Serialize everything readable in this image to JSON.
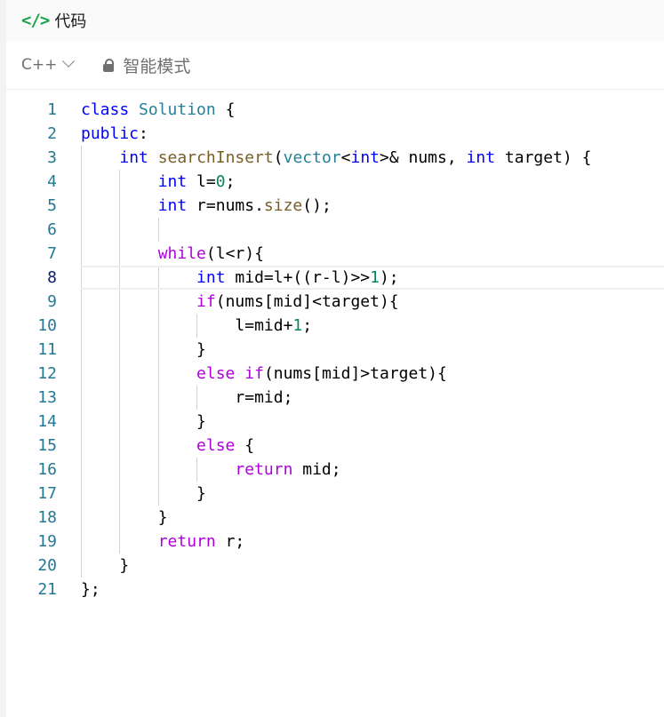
{
  "header": {
    "icon": "code-icon",
    "title": "代码",
    "icon_color": "#1aa34a"
  },
  "toolbar": {
    "language": "C++",
    "mode_icon": "lock-icon",
    "mode_label": "智能模式"
  },
  "editor": {
    "active_line": 8,
    "lines": [
      [
        [
          "class",
          "kw"
        ],
        [
          " ",
          "txt"
        ],
        [
          "Solution",
          "type"
        ],
        [
          " {",
          "txt"
        ]
      ],
      [
        [
          "public",
          "kw"
        ],
        [
          ":",
          "txt"
        ]
      ],
      [
        [
          "    ",
          "txt"
        ],
        [
          "int",
          "kw"
        ],
        [
          " ",
          "txt"
        ],
        [
          "searchInsert",
          "fn"
        ],
        [
          "(",
          "txt"
        ],
        [
          "vector",
          "type"
        ],
        [
          "<",
          "txt"
        ],
        [
          "int",
          "kw"
        ],
        [
          ">& nums, ",
          "txt"
        ],
        [
          "int",
          "kw"
        ],
        [
          " target) {",
          "txt"
        ]
      ],
      [
        [
          "        ",
          "txt"
        ],
        [
          "int",
          "kw"
        ],
        [
          " l=",
          "txt"
        ],
        [
          "0",
          "num"
        ],
        [
          ";",
          "txt"
        ]
      ],
      [
        [
          "        ",
          "txt"
        ],
        [
          "int",
          "kw"
        ],
        [
          " r=nums.",
          "txt"
        ],
        [
          "size",
          "fn"
        ],
        [
          "();",
          "txt"
        ]
      ],
      [],
      [
        [
          "        ",
          "txt"
        ],
        [
          "while",
          "ctl"
        ],
        [
          "(l<r){",
          "txt"
        ]
      ],
      [
        [
          "            ",
          "txt"
        ],
        [
          "int",
          "kw"
        ],
        [
          " mid=l+((r-l)>>",
          "txt"
        ],
        [
          "1",
          "num"
        ],
        [
          ");",
          "txt"
        ]
      ],
      [
        [
          "            ",
          "txt"
        ],
        [
          "if",
          "ctl"
        ],
        [
          "(nums[mid]<target){",
          "txt"
        ]
      ],
      [
        [
          "                l=mid+",
          "txt"
        ],
        [
          "1",
          "num"
        ],
        [
          ";",
          "txt"
        ]
      ],
      [
        [
          "            }",
          "txt"
        ]
      ],
      [
        [
          "            ",
          "txt"
        ],
        [
          "else",
          "ctl"
        ],
        [
          " ",
          "txt"
        ],
        [
          "if",
          "ctl"
        ],
        [
          "(nums[mid]>target){",
          "txt"
        ]
      ],
      [
        [
          "                r=mid;",
          "txt"
        ]
      ],
      [
        [
          "            }",
          "txt"
        ]
      ],
      [
        [
          "            ",
          "txt"
        ],
        [
          "else",
          "ctl"
        ],
        [
          " {",
          "txt"
        ]
      ],
      [
        [
          "                ",
          "txt"
        ],
        [
          "return",
          "ctl"
        ],
        [
          " mid;",
          "txt"
        ]
      ],
      [
        [
          "            }",
          "txt"
        ]
      ],
      [
        [
          "        }",
          "txt"
        ]
      ],
      [
        [
          "        ",
          "txt"
        ],
        [
          "return",
          "ctl"
        ],
        [
          " r;",
          "txt"
        ]
      ],
      [
        [
          "    }",
          "txt"
        ]
      ],
      [
        [
          "};",
          "txt"
        ]
      ]
    ]
  }
}
